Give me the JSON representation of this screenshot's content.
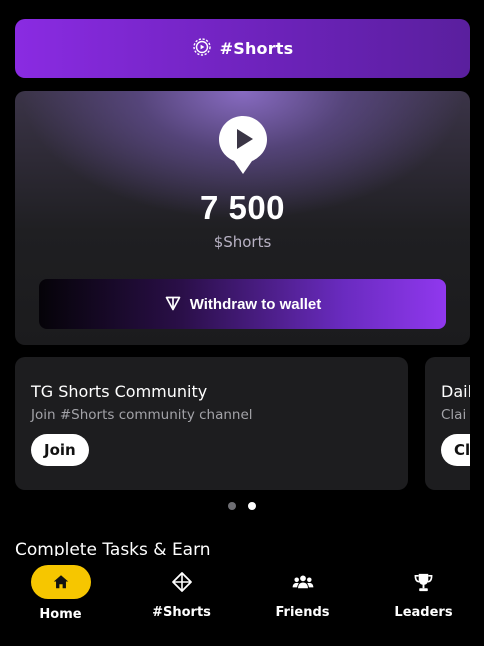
{
  "banner": {
    "label": "#Shorts",
    "icon": "play-circle-icon"
  },
  "balance": {
    "amount": "7 500",
    "unit": "$Shorts",
    "icon": "play-pin-icon"
  },
  "withdraw": {
    "label": "Withdraw to wallet",
    "icon": "ton-icon"
  },
  "tasks": [
    {
      "title": "TG Shorts Community",
      "subtitle": "Join #Shorts community channel",
      "button": "Join"
    },
    {
      "title": "Dail",
      "subtitle": "Clai",
      "button": "Cla"
    }
  ],
  "pager": {
    "count": 2,
    "active": 1
  },
  "section": {
    "title": "Complete Tasks & Earn"
  },
  "nav": [
    {
      "label": "Home",
      "icon": "home-icon",
      "active": true
    },
    {
      "label": "#Shorts",
      "icon": "shorts-icon",
      "active": false
    },
    {
      "label": "Friends",
      "icon": "friends-icon",
      "active": false
    },
    {
      "label": "Leaders",
      "icon": "trophy-icon",
      "active": false
    }
  ],
  "colors": {
    "accent": "#8a2be2",
    "nav_active": "#f6c600"
  }
}
